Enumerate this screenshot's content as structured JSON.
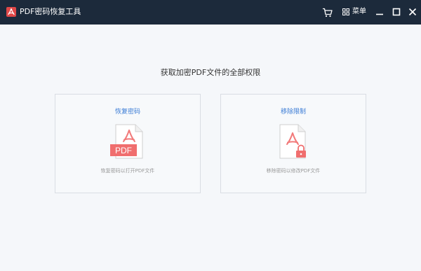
{
  "app": {
    "title": "PDF密码恢复工具",
    "menu_label": "菜单"
  },
  "main": {
    "heading": "获取加密PDF文件的全部权限",
    "cards": [
      {
        "title": "恢复密码",
        "description": "恢复密码以打开PDF文件",
        "badge": "PDF"
      },
      {
        "title": "移除限制",
        "description": "移除密码以修改PDF文件"
      }
    ]
  },
  "colors": {
    "titlebar": "#1c2a3b",
    "accent_blue": "#3a7bd5",
    "pdf_red": "#f06e6e"
  }
}
